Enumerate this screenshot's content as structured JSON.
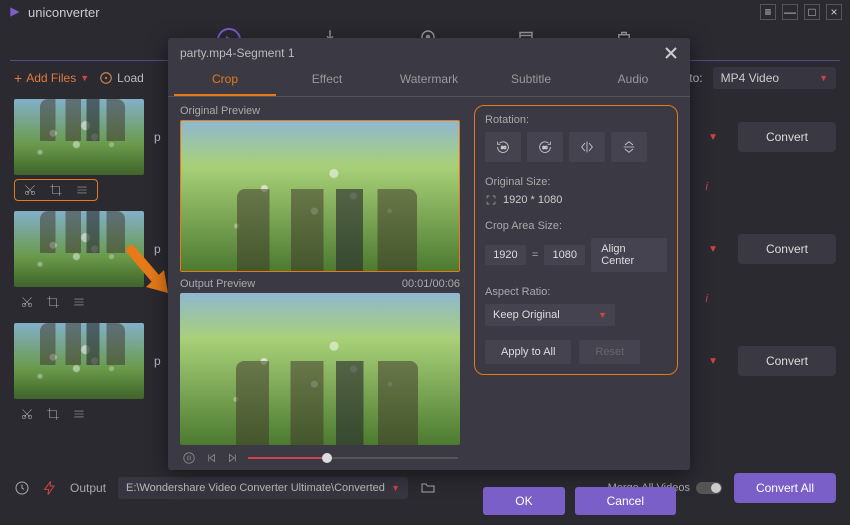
{
  "app": {
    "title": "uniconverter"
  },
  "toolbar": {
    "add_files": "Add Files",
    "load": "Load",
    "convert_to": "to:",
    "output_format": "MP4 Video"
  },
  "clips": {
    "convert_btn": "Convert"
  },
  "modal": {
    "filename": "party.mp4-Segment 1",
    "tabs": {
      "crop": "Crop",
      "effect": "Effect",
      "watermark": "Watermark",
      "subtitle": "Subtitle",
      "audio": "Audio"
    },
    "original_preview": "Original Preview",
    "output_preview": "Output Preview",
    "timecode": "00:01/00:06",
    "rotation_label": "Rotation:",
    "orig_size_label": "Original Size:",
    "orig_size_value": "1920 * 1080",
    "crop_size_label": "Crop Area Size:",
    "crop_w": "1920",
    "crop_h": "1080",
    "align_center": "Align Center",
    "aspect_label": "Aspect Ratio:",
    "aspect_value": "Keep Original",
    "apply_all": "Apply to All",
    "reset": "Reset",
    "ok": "OK",
    "cancel": "Cancel"
  },
  "footer": {
    "output_label": "Output",
    "output_path": "E:\\Wondershare Video Converter Ultimate\\Converted",
    "merge_label": "Merge All Videos",
    "convert_all": "Convert All"
  }
}
